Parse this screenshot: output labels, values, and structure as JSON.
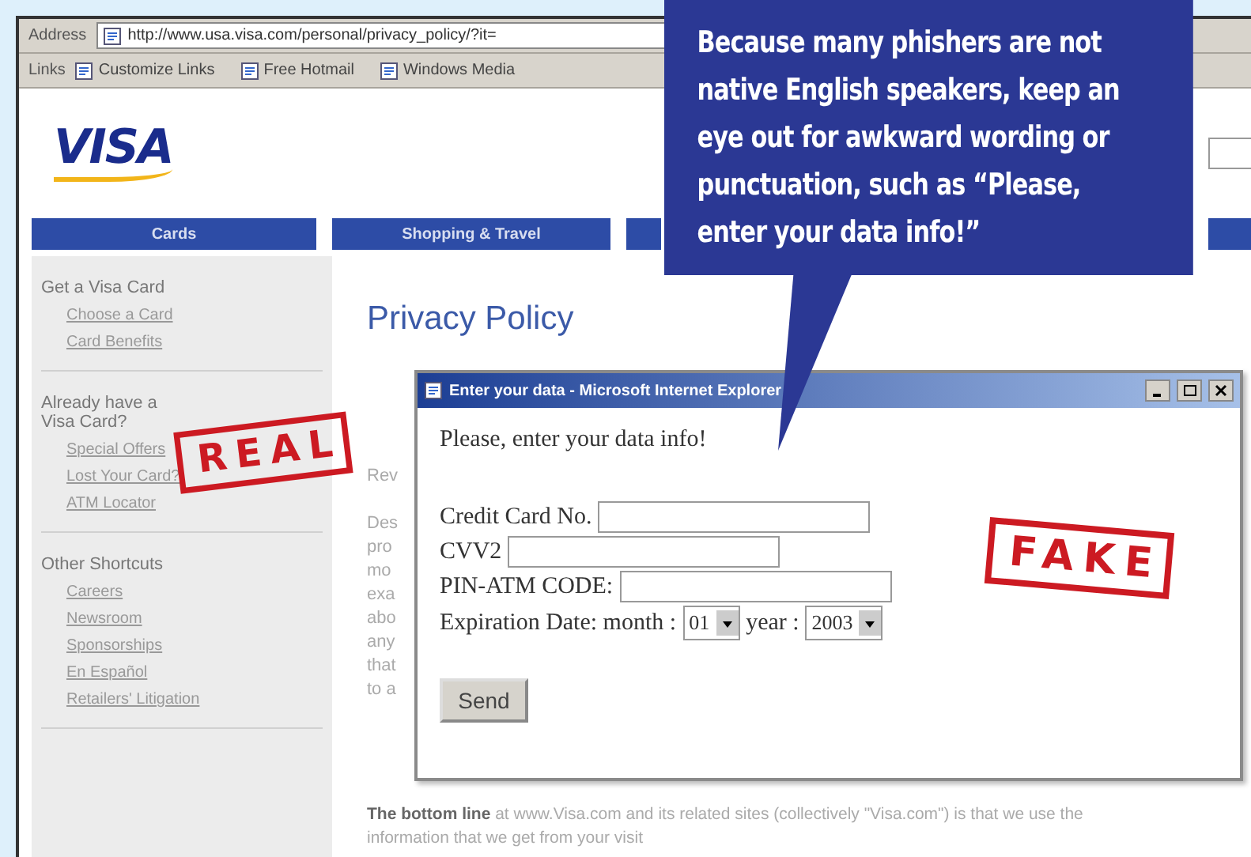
{
  "browser": {
    "address_label": "Address",
    "url": "http://www.usa.visa.com/personal/privacy_policy/?it=",
    "links_label": "Links",
    "links": [
      "Customize Links",
      "Free Hotmail",
      "Windows Media"
    ]
  },
  "site": {
    "logo": "VISA",
    "nav": [
      {
        "label": "Cards"
      },
      {
        "label": "Shopping & Travel"
      }
    ],
    "sidebar": [
      {
        "heading": "Get a Visa Card",
        "links": [
          "Choose a Card",
          "Card Benefits"
        ]
      },
      {
        "heading": "Already have a Visa Card?",
        "links": [
          "Special Offers",
          "Lost Your Card?",
          "ATM Locator"
        ]
      },
      {
        "heading": "Other Shortcuts",
        "links": [
          "Careers",
          "Newsroom",
          "Sponsorships",
          "En Español",
          "Retailers' Litigation"
        ]
      }
    ],
    "page_title": "Privacy Policy",
    "intro": "Rev",
    "fragments": [
      "Des",
      "pro",
      "mo",
      "exa",
      "abo",
      "any",
      "that",
      "to a"
    ],
    "bottom_text": "**The bottom line** at www.Visa.com and its related sites (collectively \"Visa.com\") is that we use the information that we get from your visit"
  },
  "popup": {
    "title": "Enter your data - Microsoft Internet Explorer",
    "prompt": "Please, enter your data info!",
    "fields": [
      {
        "label": "Credit Card No."
      },
      {
        "label": "CVV2"
      },
      {
        "label": "PIN-ATM CODE:"
      }
    ],
    "expiration_label": "Expiration Date: month :",
    "month": "01",
    "year_label": "year :",
    "year": "2003",
    "send": "Send"
  },
  "callout": "Because many phishers are not native English speakers, keep an eye out for awkward wording or punctuation, such as “Please, enter your data info!”",
  "stamps": [
    {
      "text": "REAL",
      "kind": "real"
    },
    {
      "text": "FAKE",
      "kind": "fake"
    }
  ]
}
